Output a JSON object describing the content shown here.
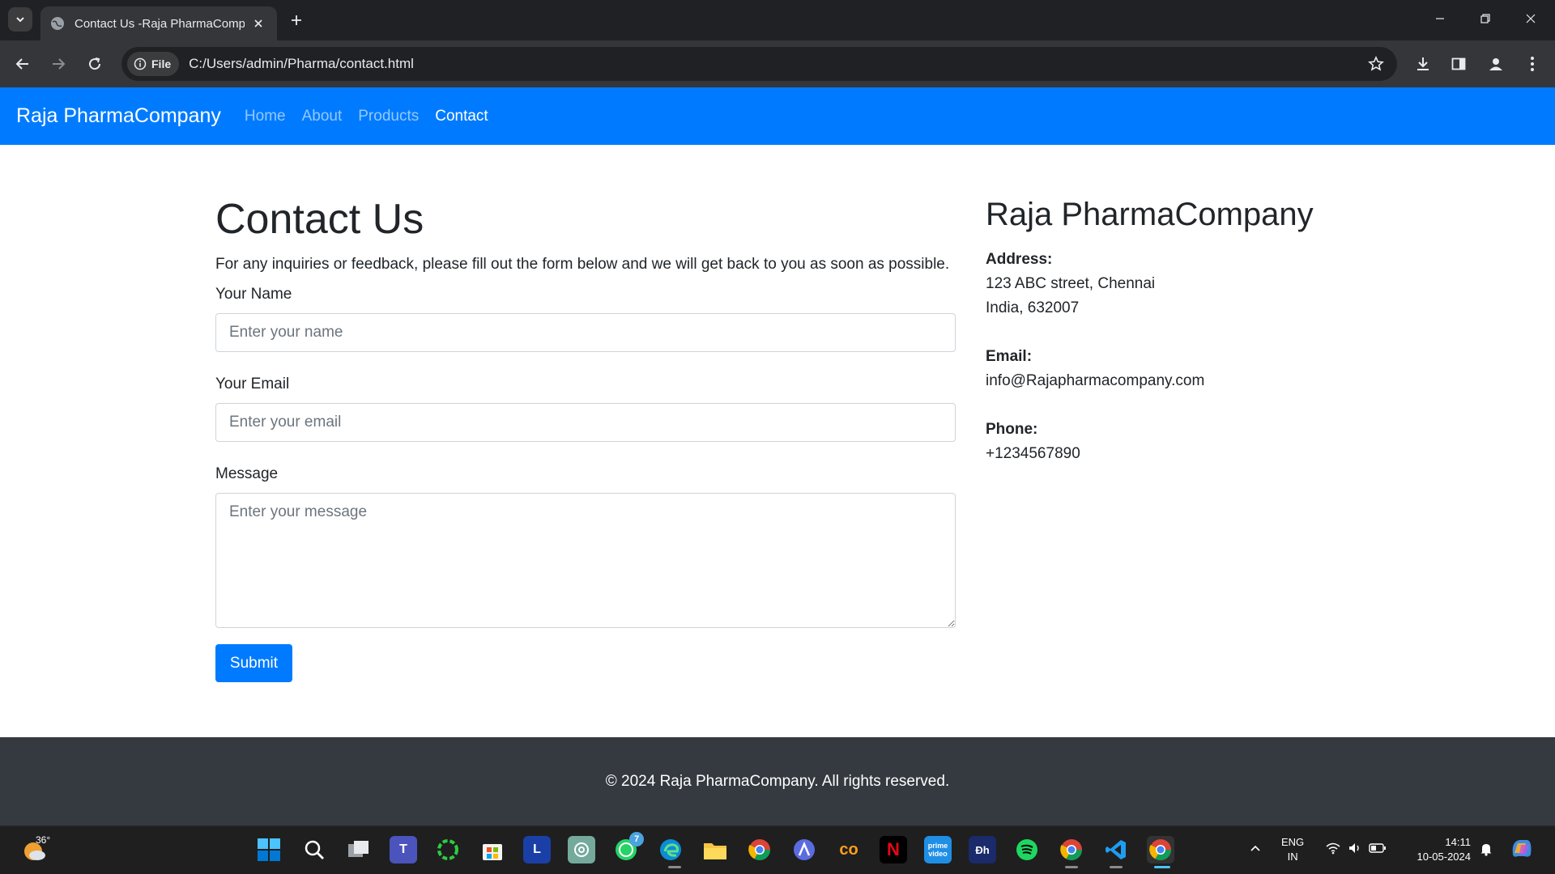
{
  "browser": {
    "tab_title": "Contact Us -Raja PharmaCompany",
    "scheme_chip": "File",
    "url": "C:/Users/admin/Pharma/contact.html"
  },
  "navbar": {
    "brand": "Raja PharmaCompany",
    "links": [
      "Home",
      "About",
      "Products",
      "Contact"
    ],
    "active": "Contact"
  },
  "contact": {
    "title": "Contact Us",
    "intro": "For any inquiries or feedback, please fill out the form below and we will get back to you as soon as possible.",
    "name_label": "Your Name",
    "name_placeholder": "Enter your name",
    "email_label": "Your Email",
    "email_placeholder": "Enter your email",
    "message_label": "Message",
    "message_placeholder": "Enter your message",
    "submit": "Submit"
  },
  "company": {
    "title": "Raja PharmaCompany",
    "address_label": "Address:",
    "address_line1": "123 ABC street, Chennai",
    "address_line2": "India, 632007",
    "email_label": "Email:",
    "email": "info@Rajapharmacompany.com",
    "phone_label": "Phone:",
    "phone": "+1234567890"
  },
  "footer": {
    "text": "© 2024 Raja PharmaCompany. All rights reserved."
  },
  "taskbar": {
    "weather_temp": "36°",
    "whatsapp_badge": "7",
    "language_line1": "ENG",
    "language_line2": "IN",
    "time": "14:11",
    "date": "10-05-2024"
  },
  "colors": {
    "navbar": "#007bff",
    "footer": "#343a40",
    "primary_button": "#007bff"
  }
}
